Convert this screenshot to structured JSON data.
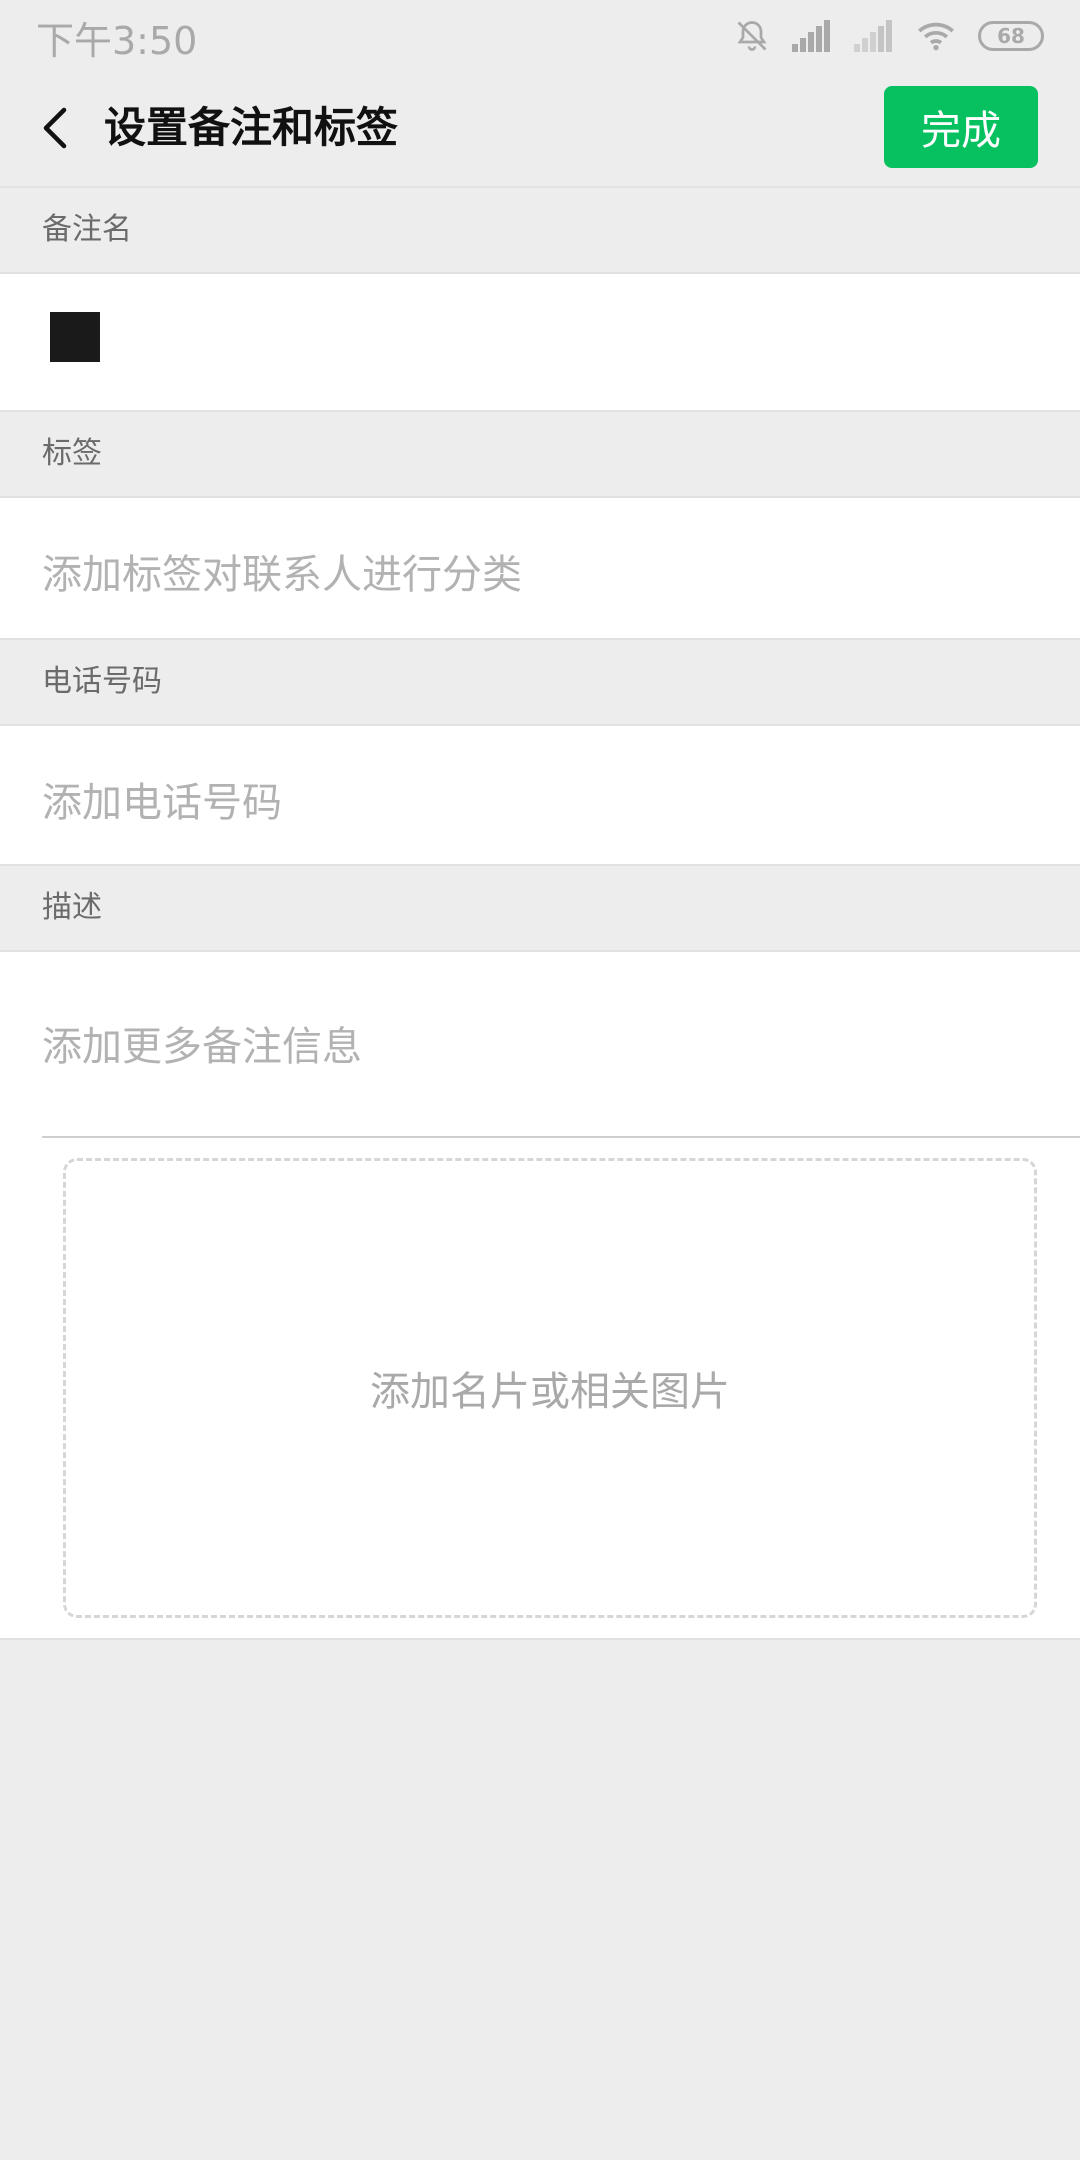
{
  "status_bar": {
    "time": "下午3:50",
    "battery": "68",
    "icons": [
      "bell-muted-icon",
      "signal-icon",
      "signal-icon",
      "wifi-icon",
      "battery-icon"
    ]
  },
  "nav": {
    "back_icon": "chevron-left-icon",
    "title": "设置备注和标签",
    "done_label": "完成"
  },
  "sections": {
    "remark_name": {
      "label": "备注名"
    },
    "tags": {
      "label": "标签",
      "placeholder": "添加标签对联系人进行分类"
    },
    "phone": {
      "label": "电话号码",
      "placeholder": "添加电话号码"
    },
    "description": {
      "label": "描述",
      "placeholder": "添加更多备注信息"
    }
  },
  "image_upload": {
    "label": "添加名片或相关图片"
  },
  "colors": {
    "accent": "#07c160",
    "background": "#ededed",
    "card": "#ffffff",
    "placeholder": "#b2b2b2"
  }
}
